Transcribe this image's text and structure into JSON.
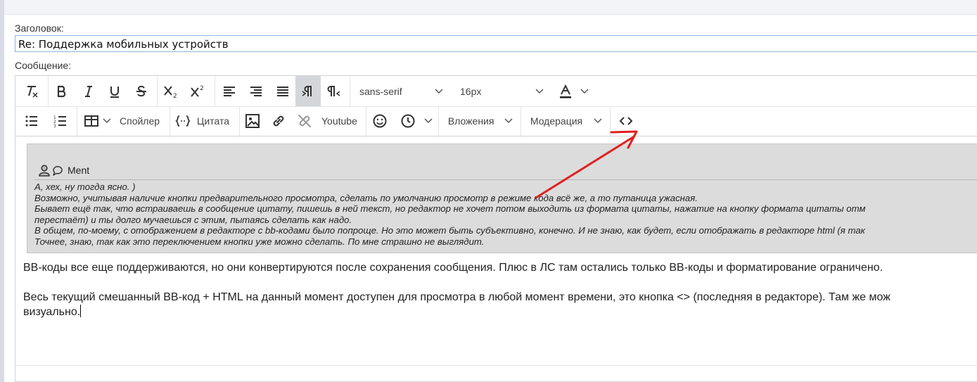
{
  "form": {
    "subject_label": "Заголовок:",
    "subject_value": "Re:  Поддержка мобильных устройств",
    "message_label": "Сообщение:"
  },
  "toolbar": {
    "row1": [
      "remove-format",
      "bold",
      "italic",
      "underline",
      "strikethrough",
      "subscript",
      "superscript",
      "align-left",
      "align-right",
      "justify",
      "ltr",
      "rtl"
    ],
    "font_family": "sans-serif",
    "font_size": "16px",
    "row2": {
      "spoiler": "Спойлер",
      "quote": "Цитата",
      "youtube": "Youtube",
      "attachments": "Вложения",
      "moderation": "Модерация"
    },
    "active_button": "ltr"
  },
  "quote": {
    "author": "Ment",
    "lines": [
      "А, хех, ну тогда ясно. )",
      "Возможно, учитывая наличие кнопки предварительного просмотра, сделать по умолчанию просмотр в режиме кода всё же, а то путаница ужасная.",
      "Бывает ещё так, что встраиваешь в сообщение цитату, пишешь в ней текст, но редактор не хочет потом выходить из формата цитаты, нажатие на кнопку формата цитаты отм",
      "перестаёт) и ты долго мучаешься с этим, пытаясь сделать как надо.",
      "В общем, по-моему, с отображением в редакторе с bb-кодами было попроще. Но это может быть субъективно, конечно. И не знаю, как будет, если отображать в редакторе html (я так",
      "Точнее, знаю, так как это переключением кнопки уже можно сделать. По мне страшно не выглядит."
    ]
  },
  "message": {
    "paragraph1": "BB-коды все еще поддерживаются, но они конвертируются после сохранения сообщения. Плюс в ЛС там остались только BB-коды и форматирование ограничено.",
    "paragraph2_line1": "Весь текущий смешанный BB-код + HTML на данный момент доступен для просмотра в любой момент времени, это кнопка <> (последняя в редакторе). Там же мож",
    "paragraph2_line2": "визуально."
  },
  "colors": {
    "annotation_arrow": "#e02020",
    "quote_bg": "#dcdcdc",
    "subject_border": "#8fb3d9",
    "active_button_bg": "#d4d6da"
  }
}
